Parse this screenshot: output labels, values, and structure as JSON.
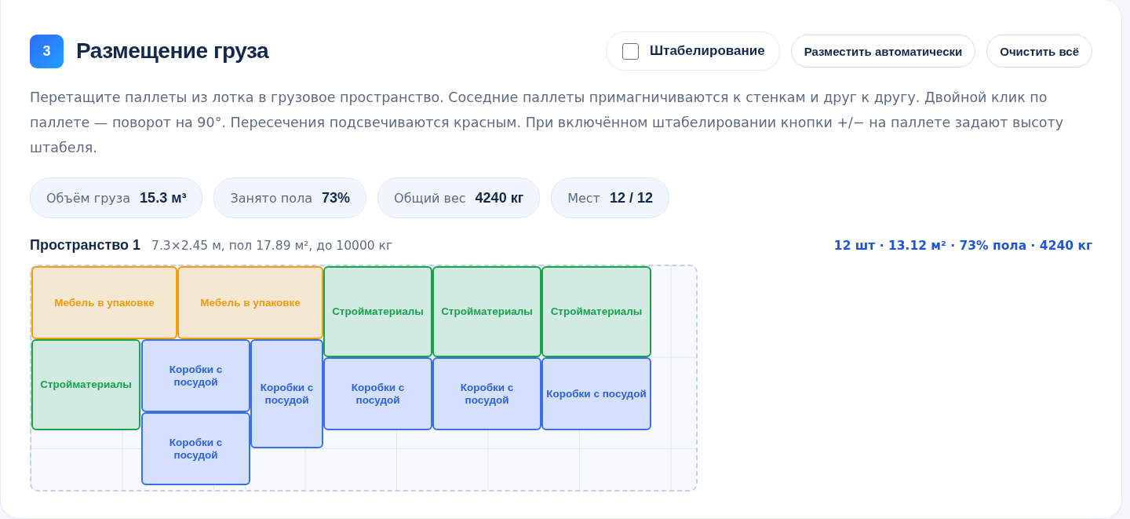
{
  "header": {
    "step": "3",
    "title": "Размещение груза",
    "stacking": {
      "label": "Штабелирование",
      "checked": false
    },
    "buttons": [
      "Разместить автоматически",
      "Очистить всё"
    ]
  },
  "description": "Перетащите паллеты из лотка в грузовое пространство. Соседние паллеты примагничиваются к стенкам и друг к другу. Двойной клик по паллете — поворот на 90°. Пересечения подсвечиваются красным. При включённом штабелировании кнопки +/− на паллете задают высоту штабеля.",
  "stats": [
    {
      "label": "Объём груза",
      "value": "15.3 м³"
    },
    {
      "label": "Занято пола",
      "value": "73%"
    },
    {
      "label": "Общий вес",
      "value": "4240 кг"
    },
    {
      "label": "Мест",
      "value": "12 / 12"
    }
  ],
  "space": {
    "title": "Пространство 1",
    "dims": "7.3×2.45 м, пол 17.89 м², до 10000 кг",
    "summary": "12 шт · 13.12 м² · 73% пола · 4240 кг",
    "pallets": [
      {
        "kind": "furniture",
        "label": "Мебель в упаковке"
      },
      {
        "kind": "furniture",
        "label": "Мебель в упаковке"
      },
      {
        "kind": "materials",
        "label": "Стройматериалы"
      },
      {
        "kind": "materials",
        "label": "Стройматериалы"
      },
      {
        "kind": "materials",
        "label": "Стройматериалы"
      },
      {
        "kind": "materials",
        "label": "Стройматериалы"
      },
      {
        "kind": "boxes",
        "label": "Коробки с посудой"
      },
      {
        "kind": "boxes",
        "label": "Коробки с посудой"
      },
      {
        "kind": "boxes",
        "label": "Коробки с посудой"
      },
      {
        "kind": "boxes",
        "label": "Коробки с посудой"
      },
      {
        "kind": "boxes",
        "label": "Коробки с посудой"
      },
      {
        "kind": "boxes",
        "label": "Коробки с посудой"
      }
    ]
  }
}
